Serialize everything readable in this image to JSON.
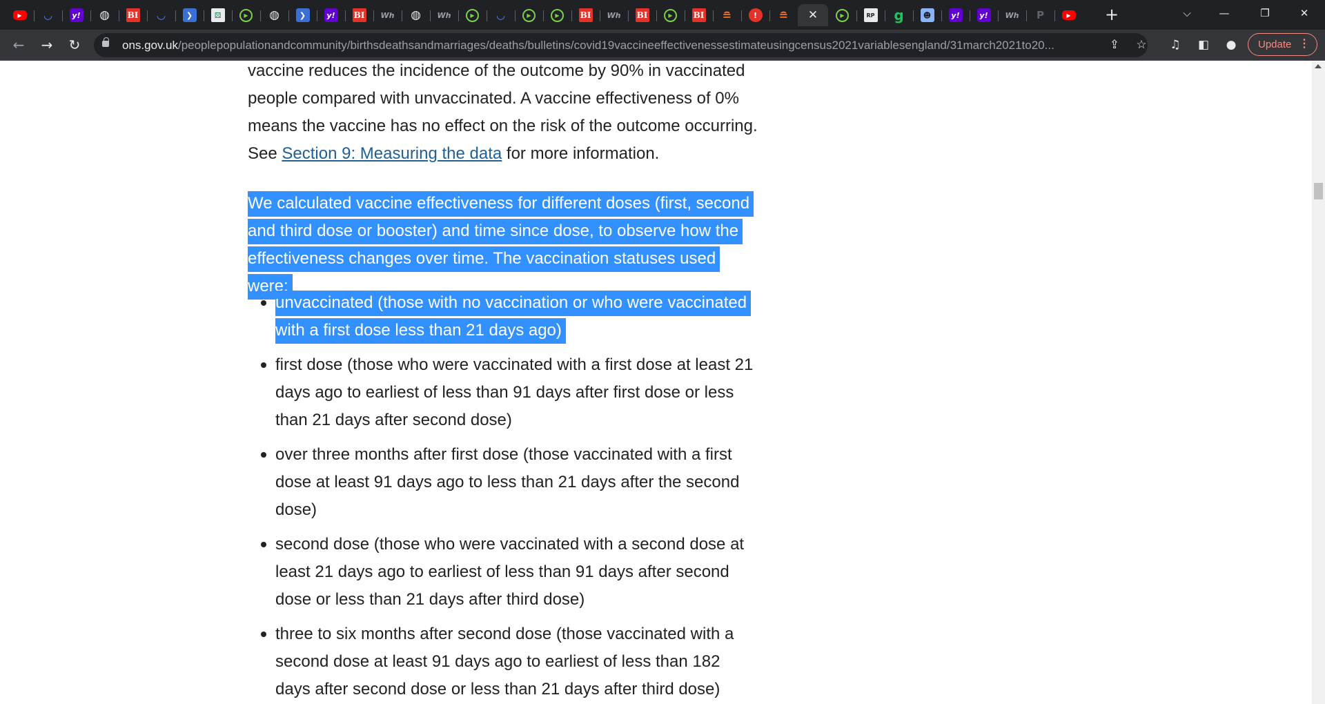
{
  "browser": {
    "tabs": [
      {
        "icon": "youtube-icon",
        "glyph": "▶"
      },
      {
        "icon": "shield-icon",
        "glyph": "◡"
      },
      {
        "icon": "yahoo-icon",
        "glyph": "y!"
      },
      {
        "icon": "globe-icon",
        "glyph": "◍"
      },
      {
        "icon": "business-insider-icon",
        "glyph": "BI"
      },
      {
        "icon": "shield-icon",
        "glyph": "◡"
      },
      {
        "icon": "arrow-pill-icon",
        "glyph": "❯"
      },
      {
        "icon": "grid-icon",
        "glyph": "⚄"
      },
      {
        "icon": "play-circle-icon",
        "glyph": "▶"
      },
      {
        "icon": "globe-icon",
        "glyph": "◍"
      },
      {
        "icon": "arrow-pill-icon",
        "glyph": "❯"
      },
      {
        "icon": "yahoo-icon",
        "glyph": "y!"
      },
      {
        "icon": "business-insider-icon",
        "glyph": "BI"
      },
      {
        "icon": "wh-icon",
        "glyph": "Wh"
      },
      {
        "icon": "globe-icon",
        "glyph": "◍"
      },
      {
        "icon": "wh-icon",
        "glyph": "Wh"
      },
      {
        "icon": "play-circle-icon",
        "glyph": "▶"
      },
      {
        "icon": "shield-icon",
        "glyph": "◡"
      },
      {
        "icon": "play-circle-icon",
        "glyph": "▶"
      },
      {
        "icon": "play-circle-icon",
        "glyph": "▶"
      },
      {
        "icon": "business-insider-icon",
        "glyph": "BI"
      },
      {
        "icon": "wh-icon",
        "glyph": "Wh"
      },
      {
        "icon": "business-insider-icon",
        "glyph": "BI"
      },
      {
        "icon": "play-circle-icon",
        "glyph": "▶"
      },
      {
        "icon": "business-insider-icon",
        "glyph": "BI"
      },
      {
        "icon": "bookmark-icon",
        "glyph": "≘"
      },
      {
        "icon": "pin-icon",
        "glyph": "!"
      },
      {
        "icon": "bookmark-icon",
        "glyph": "≘"
      },
      {
        "icon": "close-icon",
        "glyph": "✕",
        "active": true
      },
      {
        "icon": "play-circle-icon",
        "glyph": "▶"
      },
      {
        "icon": "rp-icon",
        "glyph": "RP"
      },
      {
        "icon": "g-icon",
        "glyph": "g"
      },
      {
        "icon": "mask-icon",
        "glyph": "☻"
      },
      {
        "icon": "yahoo-icon",
        "glyph": "y!"
      },
      {
        "icon": "yahoo-icon",
        "glyph": "y!"
      },
      {
        "icon": "wh-icon",
        "glyph": "Wh"
      },
      {
        "icon": "p-icon",
        "glyph": "P"
      },
      {
        "icon": "youtube-icon",
        "glyph": "▶"
      }
    ],
    "new_tab": "+",
    "window_controls": {
      "menu": "⌵",
      "minimize": "—",
      "restore": "❐",
      "close": "✕"
    },
    "nav": {
      "back": "←",
      "forward": "→",
      "reload": "↻"
    },
    "url_host": "ons.gov.uk",
    "url_path": "/peoplepopulationandcommunity/birthsdeathsandmarriages/deaths/bulletins/covid19vaccineeffectivenessestimateusingcensus2021variablesengland/31march2021to20...",
    "omnibox_icons": {
      "share": "⇪",
      "star": "☆"
    },
    "toolbar_icons": {
      "media": "♫",
      "sidepanel": "◧",
      "profile": "●"
    },
    "update_label": "Update",
    "update_menu": "⋮"
  },
  "article": {
    "para1_l1": "vaccine reduces the incidence of the outcome by 90% in vaccinated",
    "para1_l2": "people compared with unvaccinated. A vaccine effectiveness of 0%",
    "para1_l3": "means the vaccine has no effect on the risk of the outcome occurring.",
    "para1_see": "See ",
    "para1_link": "Section 9: Measuring the data",
    "para1_end": " for more information.",
    "para2": "We calculated vaccine effectiveness for different doses (first, second and third dose or booster) and time since dose, to observe how the effectiveness changes over time. The vaccination statuses used were:",
    "statuses": [
      "unvaccinated (those with no vaccination or who were vaccinated with a first dose less than 21 days ago)",
      "first dose (those who were vaccinated with a first dose at least 21 days ago to earliest of less than 91 days after first dose or less than 21 days after second dose)",
      "over three months after first dose (those vaccinated with a first dose at least 91 days ago to less than 21 days after the second dose)",
      "second dose (those who were vaccinated with a second dose at least 21 days ago to earliest of less than 91 days after second dose or less than 21 days after third dose)",
      "three to six months after second dose (those vaccinated with a second dose at least 91 days ago to earliest of less than 182 days after second dose or less than 21 days after third dose)"
    ]
  },
  "colors": {
    "selection": "#3390ff",
    "link": "#206095",
    "update_accent": "#f28b82"
  }
}
